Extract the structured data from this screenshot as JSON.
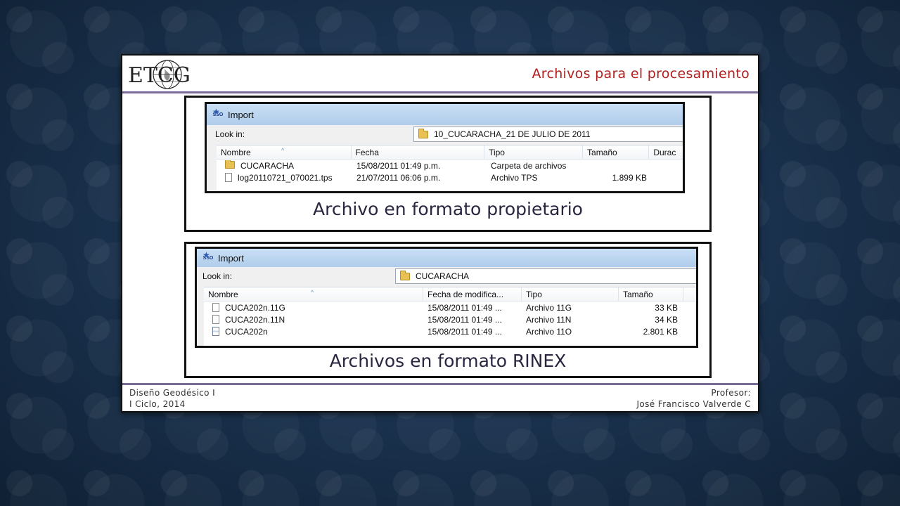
{
  "slide": {
    "title": "Archivos para el procesamiento",
    "logo_text": "ETCG"
  },
  "panel1": {
    "dialog_title": "Import",
    "app_icon_label": "SSO",
    "lookin_label": "Look in:",
    "lookin_value": "10_CUCARACHA_21 DE JULIO DE 2011",
    "columns": [
      "Nombre",
      "Fecha",
      "Tipo",
      "Tamaño",
      "Durac"
    ],
    "rows": [
      {
        "name": "CUCARACHA",
        "date": "15/08/2011 01:49 p.m.",
        "type": "Carpeta de archivos",
        "size": "",
        "icon": "folder-icon"
      },
      {
        "name": "log20110721_070021.tps",
        "date": "21/07/2011 06:06 p.m.",
        "type": "Archivo TPS",
        "size": "1.899 KB",
        "icon": "file-icon"
      }
    ],
    "caption": "Archivo en formato propietario"
  },
  "panel2": {
    "dialog_title": "Import",
    "app_icon_label": "SSO",
    "lookin_label": "Look in:",
    "lookin_value": "CUCARACHA",
    "columns": [
      "Nombre",
      "Fecha de modifica...",
      "Tipo",
      "Tamaño"
    ],
    "rows": [
      {
        "name": "CUCA202n.11G",
        "date": "15/08/2011 01:49 ...",
        "type": "Archivo 11G",
        "size": "33 KB",
        "icon": "file-icon"
      },
      {
        "name": "CUCA202n.11N",
        "date": "15/08/2011 01:49 ...",
        "type": "Archivo 11N",
        "size": "34 KB",
        "icon": "file-icon"
      },
      {
        "name": "CUCA202n",
        "date": "15/08/2011 01:49 ...",
        "type": "Archivo 11O",
        "size": "2.801 KB",
        "icon": "rinex-file-icon"
      }
    ],
    "caption": "Archivos en formato RINEX"
  },
  "footer": {
    "course": "Diseño Geodésico I",
    "term": "I Ciclo, 2014",
    "professor_label": "Profesor:",
    "professor_name": "José Francisco Valverde C"
  },
  "colors": {
    "title": "#b21e1e",
    "rule": "#7a6a9a",
    "background": "#1b3350"
  }
}
